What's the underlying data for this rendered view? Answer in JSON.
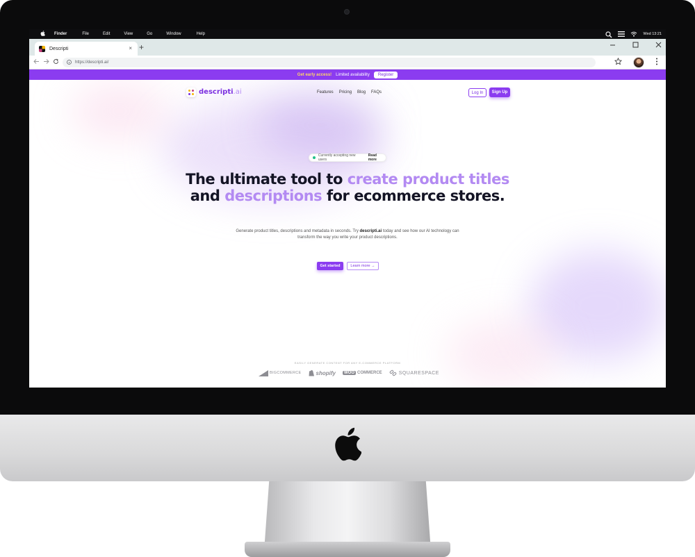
{
  "menubar": {
    "items": [
      "Finder",
      "File",
      "Edit",
      "View",
      "Go",
      "Window",
      "Help"
    ],
    "clock": "Wed 13:21"
  },
  "browser": {
    "tab_title": "Descripti",
    "url": "https://descripti.ai/",
    "new_tab": "+",
    "tab_close": "×"
  },
  "site": {
    "banner": {
      "early": "Get early access!",
      "limited": "Limited availability",
      "register": "Register"
    },
    "logo": {
      "name": "descripti",
      "suffix": ".ai"
    },
    "nav": [
      "Features",
      "Pricing",
      "Blog",
      "FAQs"
    ],
    "login": "Log In",
    "signup": "Sign Up",
    "status_pill": {
      "text": "Currently accepting new users",
      "link": "Read more"
    },
    "headline": {
      "p1": "The ultimate tool to ",
      "h1": "create product titles",
      "p2": " and ",
      "h2": "descriptions",
      "p3": " for ecommerce stores."
    },
    "subtext": {
      "a": "Generate product titles, descriptions and metadata in seconds. Try ",
      "brand": "descripti.ai",
      "b": " today and see how our AI technology can transform the way you write your product descriptions."
    },
    "cta_primary": "Get started",
    "cta_secondary": "Learn more →",
    "platforms_label": "EASILY GENERATE CONTENT FOR ANY E-COMMERCE PLATFORM",
    "platforms": [
      "BIGCOMMERCE",
      "shopify",
      "WOO",
      "COMMERCE",
      "SQUARESPACE"
    ]
  },
  "colors": {
    "brand": "#8b3cf0",
    "highlight": "#b38af2",
    "banner_accent": "#ffd766"
  },
  "icons": [
    "apple-icon",
    "search-icon",
    "list-icon",
    "wifi-icon",
    "back-icon",
    "forward-icon",
    "reload-icon",
    "star-icon",
    "kebab-icon"
  ]
}
